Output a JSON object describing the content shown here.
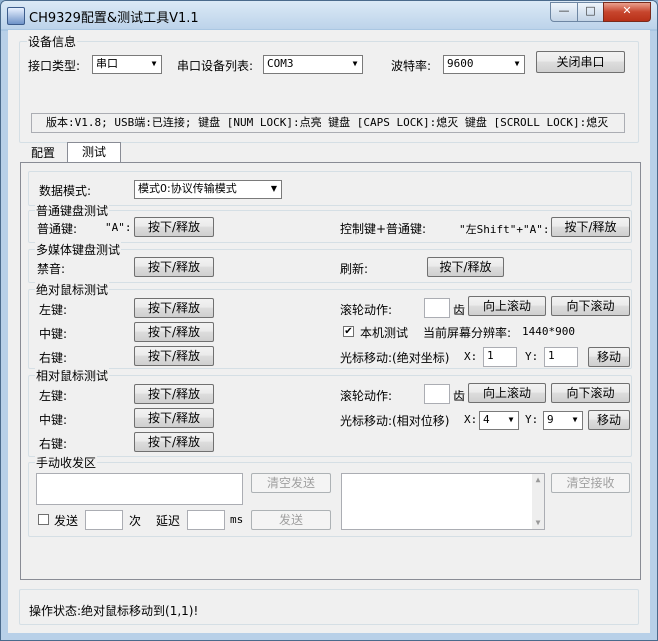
{
  "window": {
    "title": "CH9329配置&测试工具V1.1",
    "min": "—",
    "max": "□",
    "close": "✕"
  },
  "device": {
    "group_label": "设备信息",
    "interface_label": "接口类型:",
    "interface_value": "串口",
    "port_list_label": "串口设备列表:",
    "port_value": "COM3",
    "baud_label": "波特率:",
    "baud_value": "9600",
    "close_port_button": "关闭串口",
    "status_bar": "版本:V1.8;  USB端:已连接;  键盘 [NUM LOCK]:点亮  键盘 [CAPS LOCK]:熄灭  键盘 [SCROLL LOCK]:熄灭"
  },
  "tabs": [
    {
      "label": "配置"
    },
    {
      "label": "测试"
    }
  ],
  "test": {
    "data_mode_label": "数据模式:",
    "data_mode_value": "模式0:协议传输模式",
    "keyboard": {
      "group_label": "普通键盘测试",
      "normal_label": "普通键:",
      "normal_key": "\"A\":",
      "normal_button": "按下/释放",
      "ctrl_label": "控制键+普通键:",
      "ctrl_key": "\"左Shift\"+\"A\":",
      "ctrl_button": "按下/释放"
    },
    "media": {
      "group_label": "多媒体键盘测试",
      "mute_label": "禁音:",
      "mute_button": "按下/释放",
      "refresh_label": "刷新:",
      "refresh_button": "按下/释放"
    },
    "abs_mouse": {
      "group_label": "绝对鼠标测试",
      "left_label": "左键:",
      "middle_label": "中键:",
      "right_label": "右键:",
      "press_release": "按下/释放",
      "wheel_label": "滚轮动作:",
      "wheel_unit": "齿",
      "scroll_up": "向上滚动",
      "scroll_down": "向下滚动",
      "local_test_label": "本机测试",
      "local_test_checked": "✔",
      "resolution_label": "当前屏幕分辨率:",
      "resolution_value": "1440*900",
      "move_label": "光标移动:(绝对坐标)",
      "x_label": "X:",
      "x_value": "1",
      "y_label": "Y:",
      "y_value": "1",
      "move_button": "移动"
    },
    "rel_mouse": {
      "group_label": "相对鼠标测试",
      "left_label": "左键:",
      "middle_label": "中键:",
      "right_label": "右键:",
      "press_release": "按下/释放",
      "wheel_label": "滚轮动作:",
      "wheel_unit": "齿",
      "scroll_up": "向上滚动",
      "scroll_down": "向下滚动",
      "move_label": "光标移动:(相对位移)",
      "x_label": "X:",
      "x_value": "4",
      "y_label": "Y:",
      "y_value": "9",
      "move_button": "移动"
    },
    "manual": {
      "group_label": "手动收发区",
      "clear_send": "清空发送",
      "send_label": "发送",
      "times_label": "次",
      "delay_label": "延迟",
      "ms_label": "ms",
      "send_button": "发送",
      "clear_recv": "清空接收"
    }
  },
  "status": {
    "text": "操作状态:绝对鼠标移动到(1,1)!"
  }
}
